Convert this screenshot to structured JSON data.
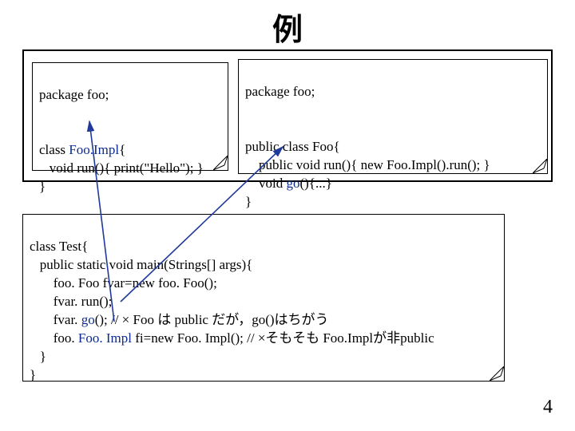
{
  "title": "例",
  "pagenum": "4",
  "note1": {
    "package": "package foo;",
    "l1a": "class ",
    "l1b": "Foo.Impl",
    "l1c": "{",
    "l2": "   void run(){ print(\"Hello\"); }",
    "l3": "}"
  },
  "note2": {
    "package": "package foo;",
    "l1": "public class Foo{",
    "l2": "    public void run(){ new Foo.Impl().run(); }",
    "l3a": "    void ",
    "l3b": "go",
    "l3c": "(){...}",
    "l4": "}"
  },
  "note3": {
    "l1": "class Test{",
    "l2": "   public static void main(Strings[] args){",
    "l3": "       foo. Foo fvar=new foo. Foo();",
    "l4": "       fvar. run();",
    "l5a": "       fvar. ",
    "l5b": "go",
    "l5c": "(); // × Foo は public だが，go()はちがう",
    "l6a": "       foo. ",
    "l6b": "Foo. Impl",
    "l6c": " fi=new Foo. Impl(); // ×そもそも Foo.Implが非public",
    "l7": "   }",
    "l8": "}"
  }
}
